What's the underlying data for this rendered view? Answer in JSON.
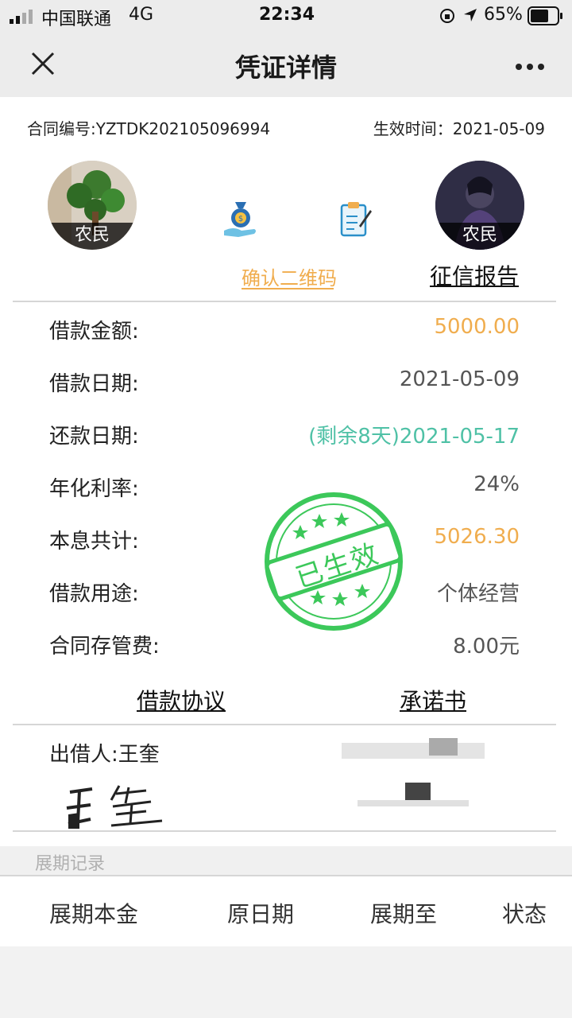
{
  "status": {
    "carrier": "中国联通",
    "network": "4G",
    "time": "22:34",
    "battery": "65%"
  },
  "nav": {
    "title": "凭证详情"
  },
  "contract": {
    "number": "合同编号:YZTDK202105096994",
    "effective": "生效时间：2021-05-09"
  },
  "parties": {
    "left_tag": "农民",
    "right_tag": "农民"
  },
  "actions": {
    "qr": "确认二维码",
    "credit": "征信报告"
  },
  "details": [
    {
      "label": "借款金额:",
      "value": "5000.00",
      "color": "#f0ad4e"
    },
    {
      "label": "借款日期:",
      "value": "2021-05-09",
      "color": "#555555"
    },
    {
      "label": "还款日期:",
      "value": "(剩余8天)2021-05-17",
      "color": "#4fc1a6"
    },
    {
      "label": "年化利率:",
      "value": "24%",
      "color": "#555555"
    },
    {
      "label": "本息共计:",
      "value": "5026.30",
      "color": "#f0ad4e"
    },
    {
      "label": "借款用途:",
      "value": "个体经营",
      "color": "#555555"
    },
    {
      "label": "合同存管费:",
      "value": "8.00元",
      "color": "#555555"
    }
  ],
  "stamp": {
    "text": "已生效",
    "color": "#3cc85a"
  },
  "docs": {
    "agreement": "借款协议",
    "promise": "承诺书"
  },
  "lender": {
    "label": "出借人:王奎"
  },
  "extension": {
    "title": "展期记录",
    "columns": [
      "展期本金",
      "原日期",
      "展期至",
      "状态"
    ]
  }
}
